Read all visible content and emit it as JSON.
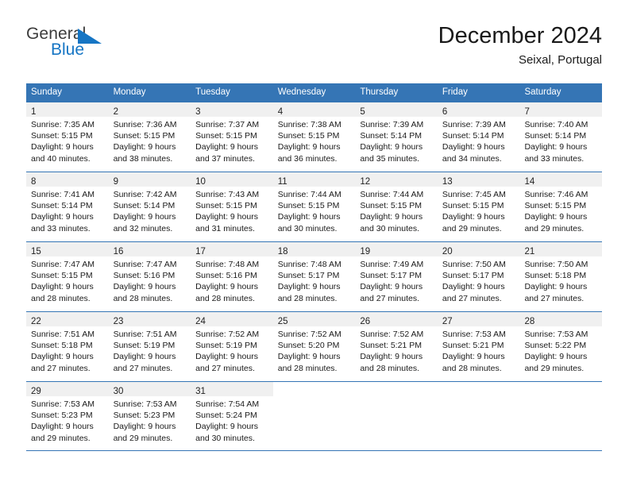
{
  "brand": {
    "line1": "General",
    "line2": "Blue",
    "mark": "triangle-logo",
    "blue": "#1575c4"
  },
  "header": {
    "title": "December 2024",
    "subtitle": "Seixal, Portugal"
  },
  "theme": {
    "header_blue": "#3575b5",
    "day_band_gray": "#f0f0f0",
    "text": "#1a1a1a"
  },
  "weekdays": [
    "Sunday",
    "Monday",
    "Tuesday",
    "Wednesday",
    "Thursday",
    "Friday",
    "Saturday"
  ],
  "weeks": [
    [
      {
        "day": "1",
        "sunrise": "Sunrise: 7:35 AM",
        "sunset": "Sunset: 5:15 PM",
        "daylight1": "Daylight: 9 hours",
        "daylight2": "and 40 minutes."
      },
      {
        "day": "2",
        "sunrise": "Sunrise: 7:36 AM",
        "sunset": "Sunset: 5:15 PM",
        "daylight1": "Daylight: 9 hours",
        "daylight2": "and 38 minutes."
      },
      {
        "day": "3",
        "sunrise": "Sunrise: 7:37 AM",
        "sunset": "Sunset: 5:15 PM",
        "daylight1": "Daylight: 9 hours",
        "daylight2": "and 37 minutes."
      },
      {
        "day": "4",
        "sunrise": "Sunrise: 7:38 AM",
        "sunset": "Sunset: 5:15 PM",
        "daylight1": "Daylight: 9 hours",
        "daylight2": "and 36 minutes."
      },
      {
        "day": "5",
        "sunrise": "Sunrise: 7:39 AM",
        "sunset": "Sunset: 5:14 PM",
        "daylight1": "Daylight: 9 hours",
        "daylight2": "and 35 minutes."
      },
      {
        "day": "6",
        "sunrise": "Sunrise: 7:39 AM",
        "sunset": "Sunset: 5:14 PM",
        "daylight1": "Daylight: 9 hours",
        "daylight2": "and 34 minutes."
      },
      {
        "day": "7",
        "sunrise": "Sunrise: 7:40 AM",
        "sunset": "Sunset: 5:14 PM",
        "daylight1": "Daylight: 9 hours",
        "daylight2": "and 33 minutes."
      }
    ],
    [
      {
        "day": "8",
        "sunrise": "Sunrise: 7:41 AM",
        "sunset": "Sunset: 5:14 PM",
        "daylight1": "Daylight: 9 hours",
        "daylight2": "and 33 minutes."
      },
      {
        "day": "9",
        "sunrise": "Sunrise: 7:42 AM",
        "sunset": "Sunset: 5:14 PM",
        "daylight1": "Daylight: 9 hours",
        "daylight2": "and 32 minutes."
      },
      {
        "day": "10",
        "sunrise": "Sunrise: 7:43 AM",
        "sunset": "Sunset: 5:15 PM",
        "daylight1": "Daylight: 9 hours",
        "daylight2": "and 31 minutes."
      },
      {
        "day": "11",
        "sunrise": "Sunrise: 7:44 AM",
        "sunset": "Sunset: 5:15 PM",
        "daylight1": "Daylight: 9 hours",
        "daylight2": "and 30 minutes."
      },
      {
        "day": "12",
        "sunrise": "Sunrise: 7:44 AM",
        "sunset": "Sunset: 5:15 PM",
        "daylight1": "Daylight: 9 hours",
        "daylight2": "and 30 minutes."
      },
      {
        "day": "13",
        "sunrise": "Sunrise: 7:45 AM",
        "sunset": "Sunset: 5:15 PM",
        "daylight1": "Daylight: 9 hours",
        "daylight2": "and 29 minutes."
      },
      {
        "day": "14",
        "sunrise": "Sunrise: 7:46 AM",
        "sunset": "Sunset: 5:15 PM",
        "daylight1": "Daylight: 9 hours",
        "daylight2": "and 29 minutes."
      }
    ],
    [
      {
        "day": "15",
        "sunrise": "Sunrise: 7:47 AM",
        "sunset": "Sunset: 5:15 PM",
        "daylight1": "Daylight: 9 hours",
        "daylight2": "and 28 minutes."
      },
      {
        "day": "16",
        "sunrise": "Sunrise: 7:47 AM",
        "sunset": "Sunset: 5:16 PM",
        "daylight1": "Daylight: 9 hours",
        "daylight2": "and 28 minutes."
      },
      {
        "day": "17",
        "sunrise": "Sunrise: 7:48 AM",
        "sunset": "Sunset: 5:16 PM",
        "daylight1": "Daylight: 9 hours",
        "daylight2": "and 28 minutes."
      },
      {
        "day": "18",
        "sunrise": "Sunrise: 7:48 AM",
        "sunset": "Sunset: 5:17 PM",
        "daylight1": "Daylight: 9 hours",
        "daylight2": "and 28 minutes."
      },
      {
        "day": "19",
        "sunrise": "Sunrise: 7:49 AM",
        "sunset": "Sunset: 5:17 PM",
        "daylight1": "Daylight: 9 hours",
        "daylight2": "and 27 minutes."
      },
      {
        "day": "20",
        "sunrise": "Sunrise: 7:50 AM",
        "sunset": "Sunset: 5:17 PM",
        "daylight1": "Daylight: 9 hours",
        "daylight2": "and 27 minutes."
      },
      {
        "day": "21",
        "sunrise": "Sunrise: 7:50 AM",
        "sunset": "Sunset: 5:18 PM",
        "daylight1": "Daylight: 9 hours",
        "daylight2": "and 27 minutes."
      }
    ],
    [
      {
        "day": "22",
        "sunrise": "Sunrise: 7:51 AM",
        "sunset": "Sunset: 5:18 PM",
        "daylight1": "Daylight: 9 hours",
        "daylight2": "and 27 minutes."
      },
      {
        "day": "23",
        "sunrise": "Sunrise: 7:51 AM",
        "sunset": "Sunset: 5:19 PM",
        "daylight1": "Daylight: 9 hours",
        "daylight2": "and 27 minutes."
      },
      {
        "day": "24",
        "sunrise": "Sunrise: 7:52 AM",
        "sunset": "Sunset: 5:19 PM",
        "daylight1": "Daylight: 9 hours",
        "daylight2": "and 27 minutes."
      },
      {
        "day": "25",
        "sunrise": "Sunrise: 7:52 AM",
        "sunset": "Sunset: 5:20 PM",
        "daylight1": "Daylight: 9 hours",
        "daylight2": "and 28 minutes."
      },
      {
        "day": "26",
        "sunrise": "Sunrise: 7:52 AM",
        "sunset": "Sunset: 5:21 PM",
        "daylight1": "Daylight: 9 hours",
        "daylight2": "and 28 minutes."
      },
      {
        "day": "27",
        "sunrise": "Sunrise: 7:53 AM",
        "sunset": "Sunset: 5:21 PM",
        "daylight1": "Daylight: 9 hours",
        "daylight2": "and 28 minutes."
      },
      {
        "day": "28",
        "sunrise": "Sunrise: 7:53 AM",
        "sunset": "Sunset: 5:22 PM",
        "daylight1": "Daylight: 9 hours",
        "daylight2": "and 29 minutes."
      }
    ],
    [
      {
        "day": "29",
        "sunrise": "Sunrise: 7:53 AM",
        "sunset": "Sunset: 5:23 PM",
        "daylight1": "Daylight: 9 hours",
        "daylight2": "and 29 minutes."
      },
      {
        "day": "30",
        "sunrise": "Sunrise: 7:53 AM",
        "sunset": "Sunset: 5:23 PM",
        "daylight1": "Daylight: 9 hours",
        "daylight2": "and 29 minutes."
      },
      {
        "day": "31",
        "sunrise": "Sunrise: 7:54 AM",
        "sunset": "Sunset: 5:24 PM",
        "daylight1": "Daylight: 9 hours",
        "daylight2": "and 30 minutes."
      },
      {
        "day": "",
        "sunrise": "",
        "sunset": "",
        "daylight1": "",
        "daylight2": ""
      },
      {
        "day": "",
        "sunrise": "",
        "sunset": "",
        "daylight1": "",
        "daylight2": ""
      },
      {
        "day": "",
        "sunrise": "",
        "sunset": "",
        "daylight1": "",
        "daylight2": ""
      },
      {
        "day": "",
        "sunrise": "",
        "sunset": "",
        "daylight1": "",
        "daylight2": ""
      }
    ]
  ]
}
